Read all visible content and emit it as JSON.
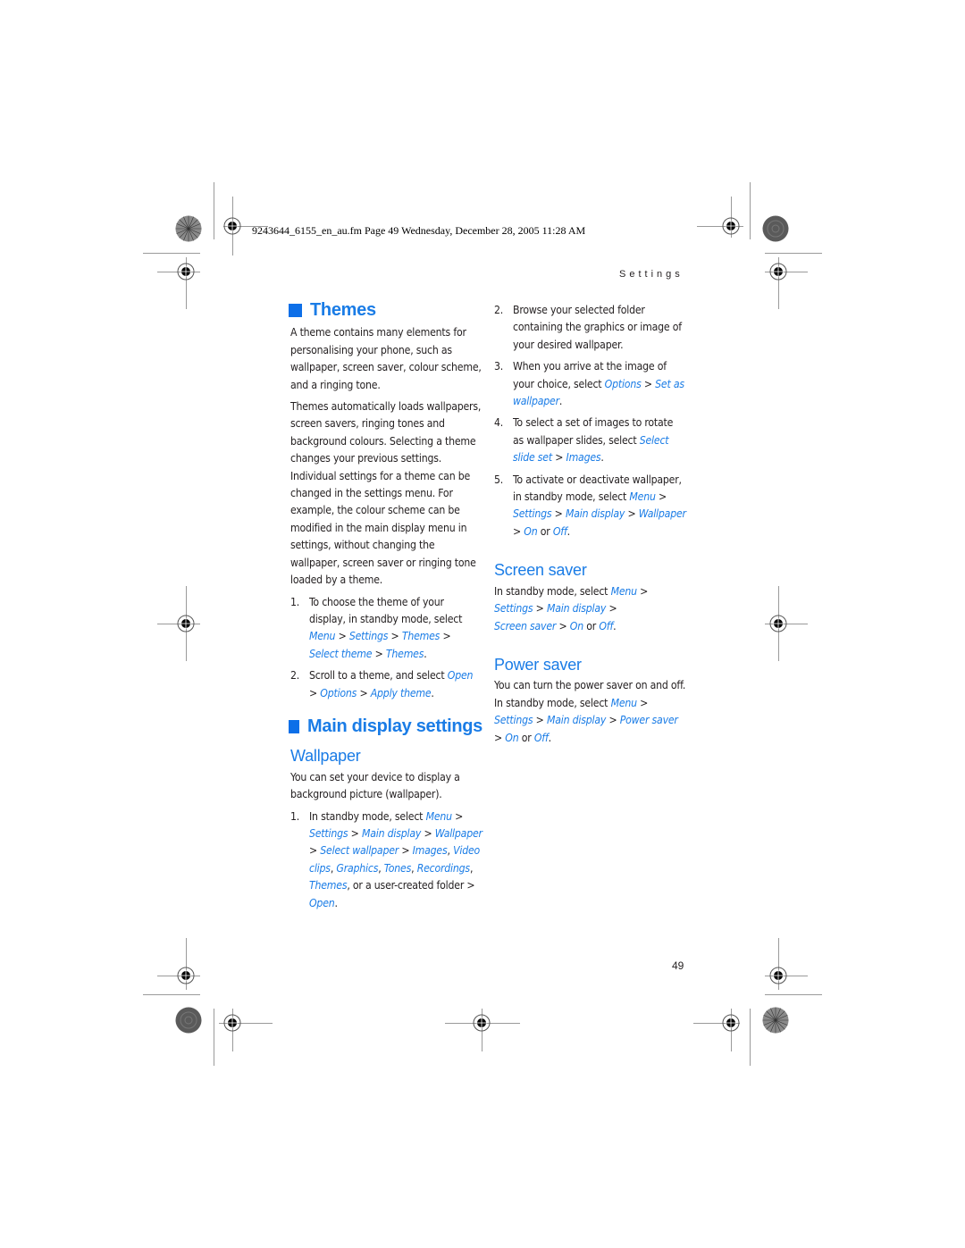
{
  "header": {
    "print_info": "9243644_6155_en_au.fm  Page 49  Wednesday, December 28, 2005  11:28 AM",
    "running_title": "Settings"
  },
  "colors": {
    "accent": "#1a7ce6",
    "text": "#231f20",
    "square": "#0d6fe8"
  },
  "themes": {
    "title": "Themes",
    "para1": "A theme contains many elements for personalising your phone, such as wallpaper, screen saver, colour scheme, and a ringing tone.",
    "para2": "Themes automatically loads wallpapers, screen savers, ringing tones and background colours. Selecting a theme changes your previous settings. Individual settings for a theme can be changed in the settings menu. For example, the colour scheme can be modified in the main display menu in settings, without changing the wallpaper, screen saver or ringing tone loaded by a theme.",
    "steps": [
      {
        "num": "1.",
        "text": "To choose the theme of your display, in standby mode, select ",
        "path": [
          "Menu",
          "Settings",
          "Themes",
          "Select theme",
          "Themes"
        ],
        "end": "."
      },
      {
        "num": "2.",
        "text": "Scroll to a theme, and select ",
        "path": [
          "Open",
          "Options",
          "Apply theme"
        ],
        "end": "."
      }
    ]
  },
  "main_display": {
    "title": "Main display settings",
    "wallpaper": {
      "title": "Wallpaper",
      "intro": "You can set your device to display a background picture (wallpaper).",
      "step1": {
        "num": "1.",
        "text": "In standby mode, select ",
        "path": [
          "Menu",
          "Settings",
          "Main display",
          "Wallpaper",
          "Select wallpaper"
        ],
        "options": [
          "Images",
          "Video clips",
          "Graphics",
          "Tones",
          "Recordings",
          "Themes"
        ],
        "or_a": ", or a user-created folder",
        "final": "Open",
        "end": "."
      },
      "step2": {
        "num": "2.",
        "text": "Browse your selected folder containing the graphics or image of your desired wallpaper."
      },
      "step3": {
        "num": "3.",
        "text": "When you arrive at the image of your choice, select ",
        "path": [
          "Options",
          "Set as wallpaper"
        ],
        "end": "."
      },
      "step4": {
        "num": "4.",
        "text": "To select a set of images to rotate as wallpaper slides, select ",
        "path": [
          "Select slide set",
          "Images"
        ],
        "end": "."
      },
      "step5": {
        "num": "5.",
        "text": "To activate or deactivate wallpaper, in standby mode, select ",
        "path": [
          "Menu",
          "Settings",
          "Main display",
          "Wallpaper"
        ],
        "on": "On",
        "or": "or",
        "off": "Off",
        "end": "."
      }
    },
    "screen_saver": {
      "title": "Screen saver",
      "text": "In standby mode, select ",
      "path": [
        "Menu",
        "Settings",
        "Main display",
        "Screen saver"
      ],
      "on": "On",
      "or": "or",
      "off": "Off",
      "end": "."
    },
    "power_saver": {
      "title": "Power saver",
      "text": "You can turn the power saver on and off. In standby mode, select ",
      "path": [
        "Menu",
        "Settings",
        "Main display",
        "Power saver"
      ],
      "on": "On",
      "or": "or",
      "off": "Off",
      "end": "."
    }
  },
  "footer": {
    "page_number": "49"
  }
}
